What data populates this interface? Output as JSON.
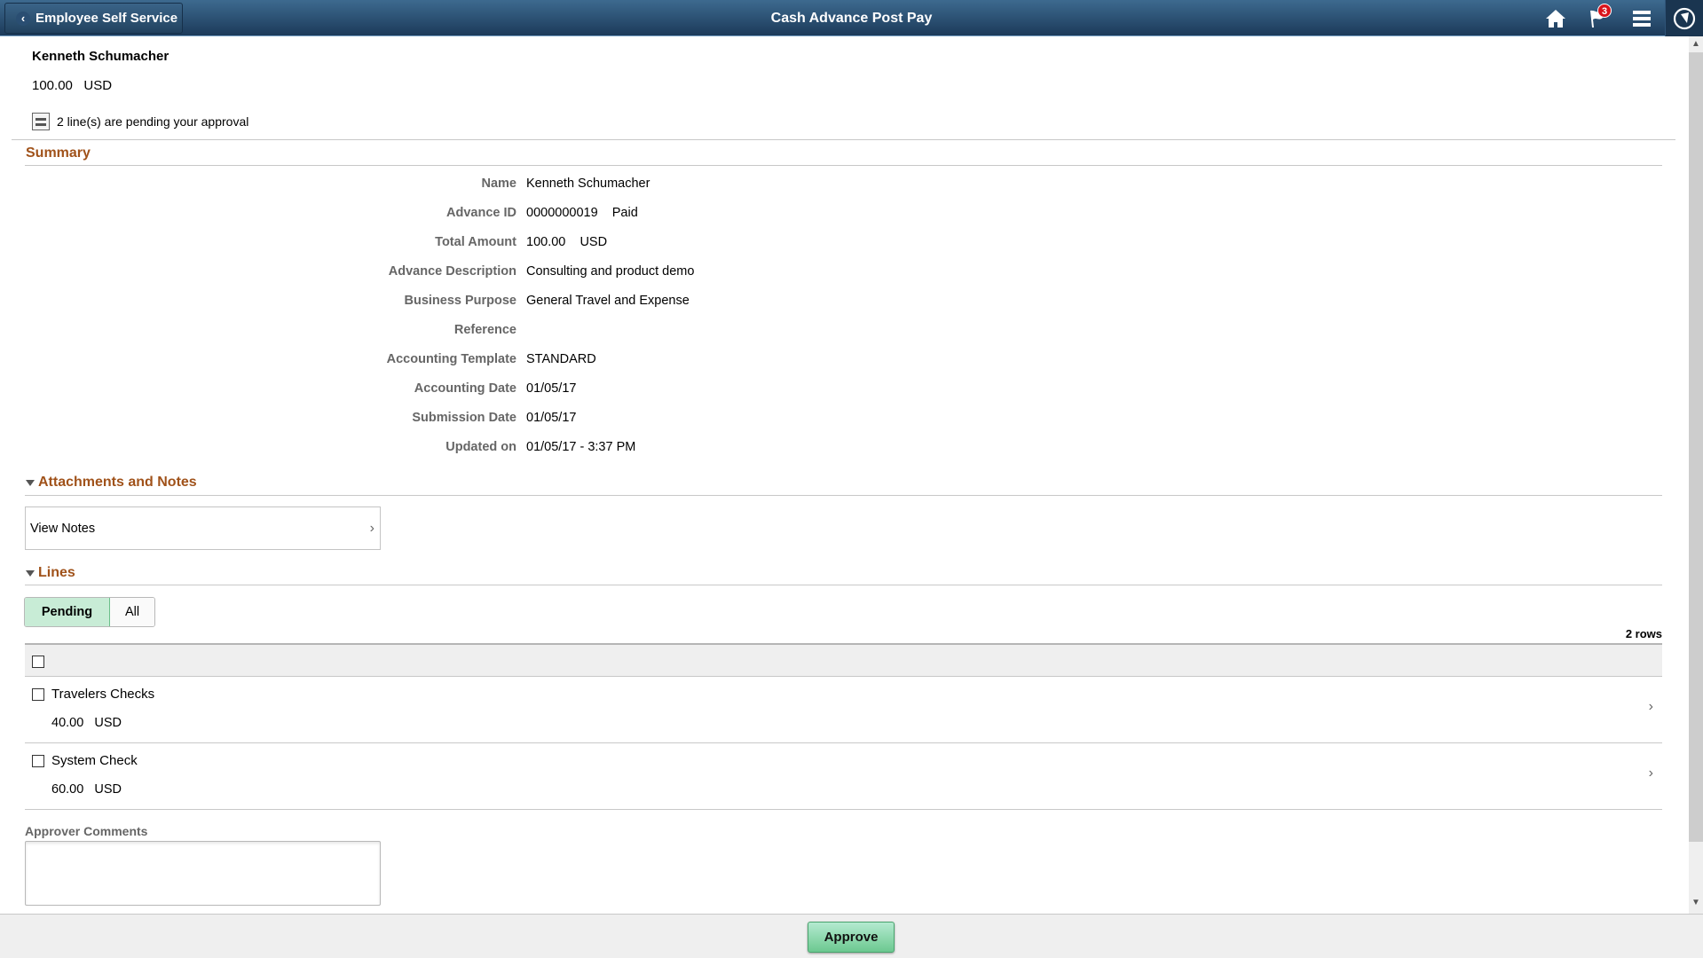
{
  "header": {
    "back_label": "Employee Self Service",
    "title": "Cash Advance Post Pay",
    "icons": [
      "home-icon",
      "notifications-flag-icon",
      "actions-menu-icon",
      "navbar-compass-icon"
    ],
    "notification_count": "3"
  },
  "employee": {
    "name": "Kenneth Schumacher",
    "amount": "100.00   USD",
    "pending_message": "2 line(s) are pending your approval"
  },
  "summary": {
    "title": "Summary",
    "fields": [
      {
        "label": "Name",
        "value": "Kenneth Schumacher"
      },
      {
        "label": "Advance ID",
        "value": "0000000019    Paid"
      },
      {
        "label": "Total Amount",
        "value": "100.00    USD"
      },
      {
        "label": "Advance Description",
        "value": "Consulting and product demo"
      },
      {
        "label": "Business Purpose",
        "value": "General Travel and Expense"
      },
      {
        "label": "Reference",
        "value": ""
      },
      {
        "label": "Accounting Template",
        "value": "STANDARD"
      },
      {
        "label": "Accounting Date",
        "value": "01/05/17"
      },
      {
        "label": "Submission Date",
        "value": "01/05/17"
      },
      {
        "label": "Updated on",
        "value": "01/05/17 - 3:37 PM"
      }
    ]
  },
  "attachments": {
    "title": "Attachments and Notes",
    "view_notes_label": "View Notes"
  },
  "lines": {
    "title": "Lines",
    "filters": [
      {
        "label": "Pending",
        "active": true
      },
      {
        "label": "All",
        "active": false
      }
    ],
    "row_count": "2 rows",
    "rows": [
      {
        "description": "Travelers Checks",
        "amount": "40.00   USD"
      },
      {
        "description": "System Check",
        "amount": "60.00   USD"
      }
    ]
  },
  "comments": {
    "label": "Approver Comments",
    "value": ""
  },
  "footer": {
    "approve_label": "Approve"
  },
  "colors": {
    "header_top": "#3d6a8f",
    "header_bottom": "#1c3a5a",
    "section_title": "#a0521a",
    "approve_green": "#6cc890",
    "badge_red": "#d8141c"
  }
}
